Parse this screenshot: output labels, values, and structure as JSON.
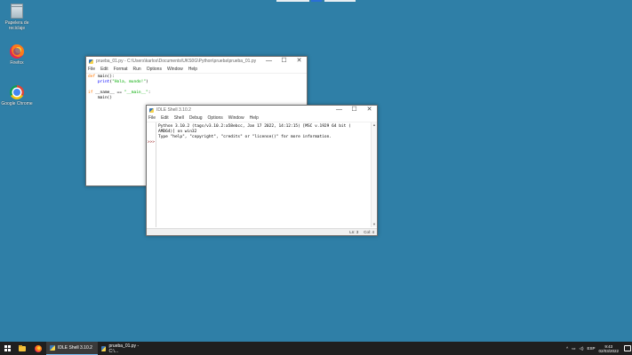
{
  "desktop": {
    "icons": [
      {
        "label": "Papelera de reciclaje"
      },
      {
        "label": "Firefox"
      },
      {
        "label": "Google Chrome"
      }
    ]
  },
  "editor": {
    "title": "prueba_01.py - C:\\Users\\karlos\\Documents\\UKS0G\\Python\\prueba\\prueba_01.py (3.10.2)",
    "menu": [
      "File",
      "Edit",
      "Format",
      "Run",
      "Options",
      "Window",
      "Help"
    ],
    "code": {
      "l1_kw": "def",
      "l1_rest": " main():",
      "l2_indent": "    ",
      "l2_fn": "print",
      "l2_open": "(",
      "l2_str": "\"Hola, mundo!\"",
      "l2_close": ")",
      "l4_kw": "if",
      "l4_rest": " __name__ == ",
      "l4_str": "\"__main__\"",
      "l4_end": ":",
      "l5": "    main()"
    },
    "controls": {
      "minimize": "—",
      "maximize": "☐",
      "close": "✕"
    }
  },
  "shell": {
    "title": "IDLE Shell 3.10.2",
    "menu": [
      "File",
      "Edit",
      "Shell",
      "Debug",
      "Options",
      "Window",
      "Help"
    ],
    "output": [
      "Python 3.10.2 (tags/v3.10.2:a58ebcc, Jan 17 2022, 14:12:15) [MSC v.1929 64 bit (",
      "AMD64)] on win32",
      "Type \"help\", \"copyright\", \"credits\" or \"license()\" for more information."
    ],
    "prompt": ">>>",
    "status": {
      "line": "Ln: 3",
      "col": "Col: 4"
    },
    "controls": {
      "minimize": "—",
      "maximize": "☐",
      "close": "✕"
    }
  },
  "taskbar": {
    "apps": [
      {
        "label": "IDLE Shell 3.10.2"
      },
      {
        "label": "prueba_01.py - C:\\..."
      }
    ],
    "tray": {
      "chevron": "^",
      "lang": "ESP",
      "time": "9:43",
      "date": "02/03/2022"
    }
  },
  "colors": {
    "desktop": "#2f7fa7",
    "keyword": "#ff7700",
    "builtin": "#0000ff",
    "string": "#00aa00",
    "prompt": "#9c2a2a"
  }
}
